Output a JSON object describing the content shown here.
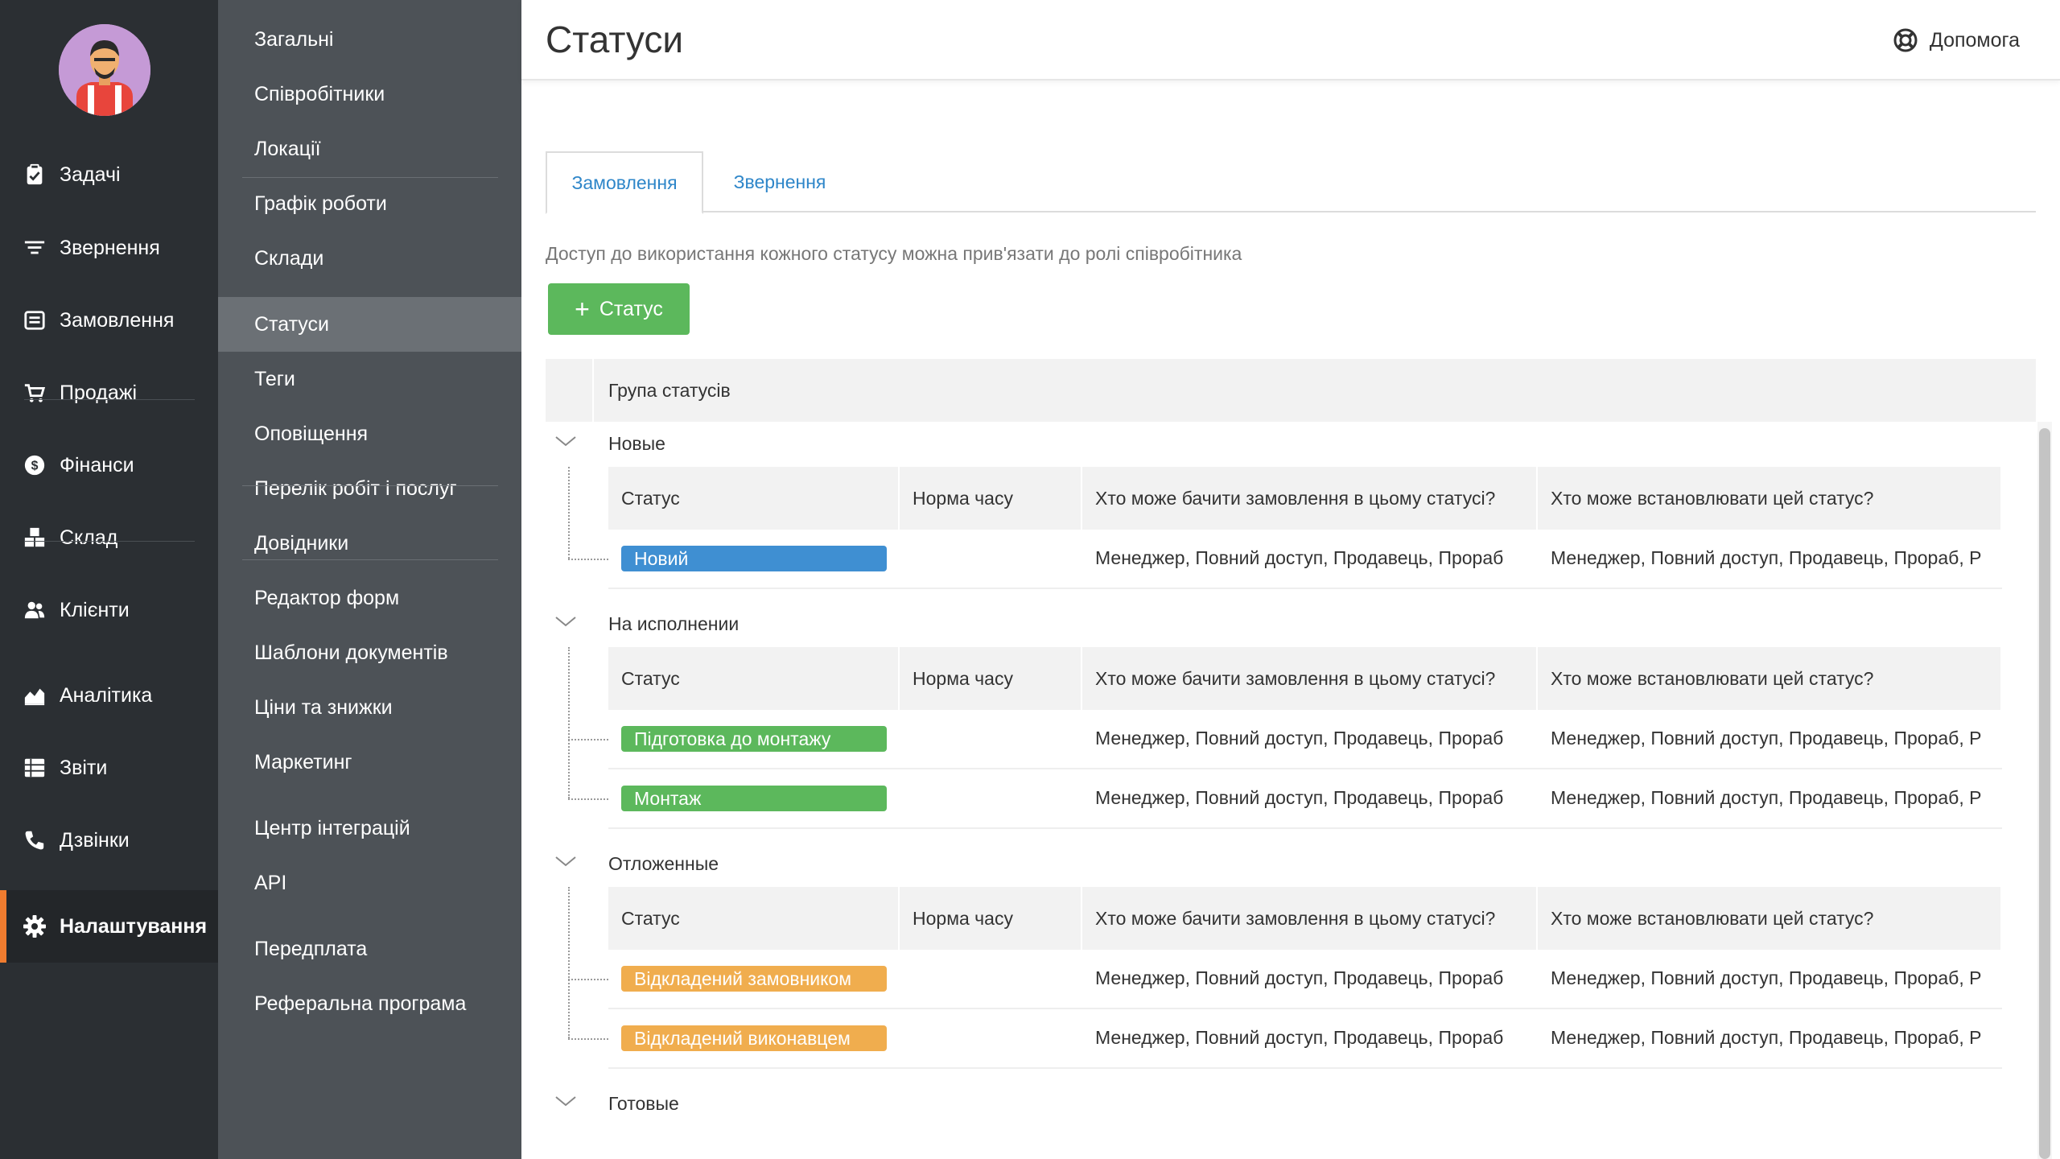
{
  "nav": {
    "items": [
      {
        "label": "Задачі",
        "icon": "clipboard-check-icon"
      },
      {
        "label": "Звернення",
        "icon": "filter-lines-icon"
      },
      {
        "label": "Замовлення",
        "icon": "order-card-icon"
      },
      {
        "label": "Продажі",
        "icon": "cart-icon"
      },
      {
        "label": "Фінанси",
        "icon": "dollar-coin-icon"
      },
      {
        "label": "Склад",
        "icon": "boxes-icon"
      },
      {
        "label": "Клієнти",
        "icon": "users-icon"
      },
      {
        "label": "Аналітика",
        "icon": "area-chart-icon"
      },
      {
        "label": "Звіти",
        "icon": "list-report-icon"
      },
      {
        "label": "Дзвінки",
        "icon": "phone-icon"
      },
      {
        "label": "Налаштування",
        "icon": "gear-icon"
      }
    ],
    "active_index": 10,
    "accent": "#f07c2f"
  },
  "settings_menu": {
    "items": [
      "Загальні",
      "Співробітники",
      "Локації",
      "Графік роботи",
      "Склади",
      "Статуси",
      "Теги",
      "Оповіщення",
      "Перелік робіт і послуг",
      "Довідники",
      "Редактор форм",
      "Шаблони документів",
      "Ціни та знижки",
      "Маркетинг",
      "Центр інтеграцій",
      "API",
      "Передплата",
      "Реферальна програма"
    ],
    "active_index": 5
  },
  "header": {
    "title": "Статуси",
    "help_label": "Допомога"
  },
  "tabs": [
    {
      "label": "Замовлення",
      "active": true
    },
    {
      "label": "Звернення",
      "active": false
    }
  ],
  "hint": "Доступ до використання кожного статусу можна прив'язати до ролі співробітника",
  "add_button_label": "Статус",
  "table": {
    "group_header": "Група статусів",
    "columns": [
      "Статус",
      "Норма часу",
      "Хто може бачити замовлення в цьому статусі?",
      "Хто може встановлювати цей статус?"
    ],
    "groups": [
      {
        "name": "Новые",
        "statuses": [
          {
            "name": "Новий",
            "color": "#3f8fd2",
            "time_norm": "",
            "who_sees": "Менеджер, Повний доступ, Продавець, Прораб",
            "who_sets": "Менеджер, Повний доступ, Продавець, Прораб, Р"
          }
        ]
      },
      {
        "name": "На исполнении",
        "statuses": [
          {
            "name": "Підготовка до монтажу",
            "color": "#5cb85c",
            "time_norm": "",
            "who_sees": "Менеджер, Повний доступ, Продавець, Прораб",
            "who_sets": "Менеджер, Повний доступ, Продавець, Прораб, Р"
          },
          {
            "name": "Монтаж",
            "color": "#5cb85c",
            "time_norm": "",
            "who_sees": "Менеджер, Повний доступ, Продавець, Прораб",
            "who_sets": "Менеджер, Повний доступ, Продавець, Прораб, Р"
          }
        ]
      },
      {
        "name": "Отложенные",
        "statuses": [
          {
            "name": "Відкладений замовником",
            "color": "#f0ad4e",
            "time_norm": "",
            "who_sees": "Менеджер, Повний доступ, Продавець, Прораб",
            "who_sets": "Менеджер, Повний доступ, Продавець, Прораб, Р"
          },
          {
            "name": "Відкладений виконавцем",
            "color": "#f0ad4e",
            "time_norm": "",
            "who_sees": "Менеджер, Повний доступ, Продавець, Прораб",
            "who_sets": "Менеджер, Повний доступ, Продавець, Прораб, Р"
          }
        ]
      },
      {
        "name": "Готовые",
        "statuses": []
      }
    ]
  }
}
